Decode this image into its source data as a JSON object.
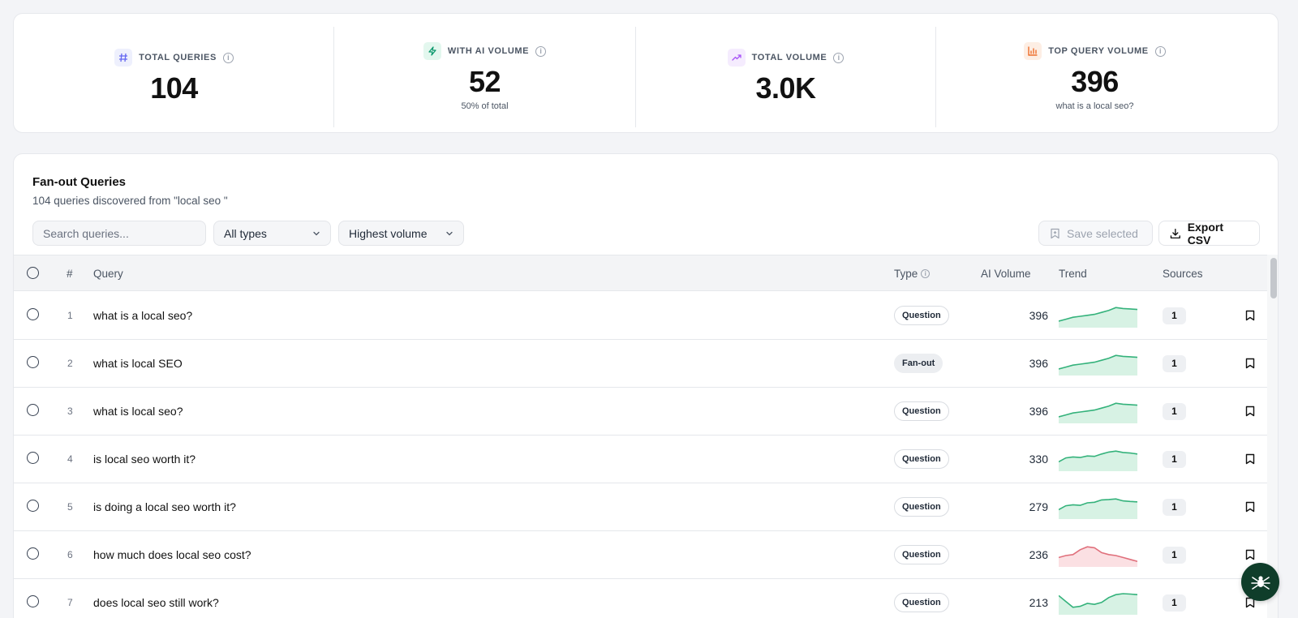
{
  "stats": [
    {
      "label": "TOTAL QUERIES",
      "value": "104",
      "sub": "",
      "icon": "hash-icon",
      "icon_color": "#6366f1",
      "icon_bg": "#eef0fd"
    },
    {
      "label": "WITH AI VOLUME",
      "value": "52",
      "sub": "50% of total",
      "icon": "zap-icon",
      "icon_color": "#059669",
      "icon_bg": "#e3f7ee"
    },
    {
      "label": "TOTAL VOLUME",
      "value": "3.0K",
      "sub": "",
      "icon": "trending-up-icon",
      "icon_color": "#a855f7",
      "icon_bg": "#f5ecfe"
    },
    {
      "label": "TOP QUERY VOLUME",
      "value": "396",
      "sub": "what is a local seo?",
      "icon": "bar-chart-icon",
      "icon_color": "#ea580c",
      "icon_bg": "#fdeee4"
    }
  ],
  "panel": {
    "title": "Fan-out Queries",
    "subtitle": "104 queries discovered from \"local seo \"",
    "search_placeholder": "Search queries...",
    "type_filter": "All types",
    "sort": "Highest volume",
    "save_label": "Save selected",
    "export_label": "Export CSV"
  },
  "columns": {
    "num": "#",
    "query": "Query",
    "type": "Type",
    "volume": "AI Volume",
    "trend": "Trend",
    "sources": "Sources"
  },
  "rows": [
    {
      "num": "1",
      "query": "what is a local seo?",
      "type": "Question",
      "volume": "396",
      "sources": "1",
      "trend": [
        0.25,
        0.35,
        0.45,
        0.5,
        0.55,
        0.6,
        0.7,
        0.8,
        0.95,
        0.9,
        0.88,
        0.85
      ],
      "trend_color": "up"
    },
    {
      "num": "2",
      "query": "what is local SEO",
      "type": "Fan-out",
      "volume": "396",
      "sources": "1",
      "trend": [
        0.25,
        0.35,
        0.45,
        0.5,
        0.55,
        0.6,
        0.7,
        0.8,
        0.95,
        0.9,
        0.88,
        0.85
      ],
      "trend_color": "up"
    },
    {
      "num": "3",
      "query": "what is local seo?",
      "type": "Question",
      "volume": "396",
      "sources": "1",
      "trend": [
        0.25,
        0.35,
        0.45,
        0.5,
        0.55,
        0.6,
        0.7,
        0.8,
        0.95,
        0.9,
        0.88,
        0.85
      ],
      "trend_color": "up"
    },
    {
      "num": "4",
      "query": "is local seo worth it?",
      "type": "Question",
      "volume": "330",
      "sources": "1",
      "trend": [
        0.4,
        0.6,
        0.65,
        0.62,
        0.7,
        0.68,
        0.8,
        0.9,
        0.95,
        0.88,
        0.85,
        0.8
      ],
      "trend_color": "up"
    },
    {
      "num": "5",
      "query": "is doing a local seo worth it?",
      "type": "Question",
      "volume": "279",
      "sources": "1",
      "trend": [
        0.4,
        0.6,
        0.65,
        0.62,
        0.75,
        0.78,
        0.9,
        0.92,
        0.95,
        0.85,
        0.82,
        0.8
      ],
      "trend_color": "up"
    },
    {
      "num": "6",
      "query": "how much does local seo cost?",
      "type": "Question",
      "volume": "236",
      "sources": "1",
      "trend": [
        0.4,
        0.5,
        0.55,
        0.8,
        0.95,
        0.9,
        0.65,
        0.55,
        0.5,
        0.4,
        0.3,
        0.2
      ],
      "trend_color": "down"
    },
    {
      "num": "7",
      "query": "does local seo still work?",
      "type": "Question",
      "volume": "213",
      "sources": "1",
      "trend": [
        0.9,
        0.6,
        0.3,
        0.35,
        0.5,
        0.45,
        0.55,
        0.8,
        0.95,
        1.0,
        0.98,
        0.95
      ],
      "trend_color": "up"
    }
  ],
  "colors": {
    "trend_up_line": "#34b27b",
    "trend_up_fill": "#d7f2e4",
    "trend_down_line": "#e0707c",
    "trend_down_fill": "#fbe0e3",
    "fab_bg": "#0f3d2a"
  }
}
